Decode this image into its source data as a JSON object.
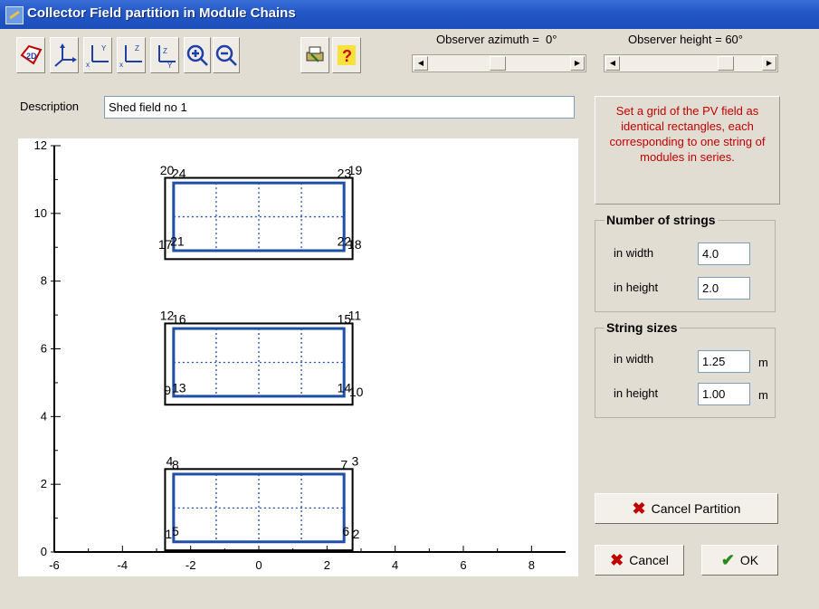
{
  "window": {
    "title": "Collector Field partition in Module Chains"
  },
  "toolbar": {
    "buttons": [
      {
        "name": "2d-view-icon",
        "glyph": "2D"
      },
      {
        "name": "3d-axes-icon"
      },
      {
        "name": "view-xy-icon"
      },
      {
        "name": "view-xz-icon"
      },
      {
        "name": "view-yz-icon"
      },
      {
        "name": "zoom-in-icon"
      },
      {
        "name": "zoom-out-icon"
      },
      {
        "name": "print-icon"
      },
      {
        "name": "help-icon",
        "glyph": "?"
      }
    ]
  },
  "observer": {
    "azimuth_label": "Observer azimuth =",
    "azimuth_value": "0°",
    "height_label": "Observer height =",
    "height_value": "60°"
  },
  "description": {
    "label": "Description",
    "value": "Shed field no 1"
  },
  "hint_text": "Set a grid of the PV field as identical rectangles, each corresponding to one string of modules in series.",
  "number_of_strings": {
    "title": "Number of strings",
    "width_label": "in width",
    "width_value": "4.0",
    "height_label": "in height",
    "height_value": "2.0"
  },
  "string_sizes": {
    "title": "String sizes",
    "width_label": "in width",
    "width_value": "1.25",
    "width_unit": "m",
    "height_label": "in height",
    "height_value": "1.00",
    "height_unit": "m"
  },
  "buttons": {
    "cancel_partition": "Cancel Partition",
    "cancel": "Cancel",
    "ok": "OK"
  },
  "colors": {
    "title_bar": "#2458c8",
    "hint_text": "#c00000",
    "field_outline": "#1e4fa8",
    "shed_outline": "#000000"
  },
  "chart_data": {
    "type": "diagram",
    "xlim": [
      -6,
      9
    ],
    "ylim": [
      0,
      12
    ],
    "x_ticks": [
      -6,
      -4,
      -2,
      0,
      2,
      4,
      6,
      8
    ],
    "y_ticks": [
      0,
      2,
      4,
      6,
      8,
      10,
      12
    ],
    "sheds": [
      {
        "outer": [
          -2.75,
          0.05,
          2.75,
          2.45
        ],
        "inner": [
          -2.5,
          0.3,
          2.5,
          2.3
        ],
        "hdiv": [
          1.3
        ],
        "vdiv": [
          -1.25,
          0,
          1.25
        ],
        "labels": [
          {
            "text": "4",
            "x": -2.72,
            "y": 2.55,
            "anchor": "start"
          },
          {
            "text": "8",
            "x": -2.55,
            "y": 2.45,
            "anchor": "start"
          },
          {
            "text": "7",
            "x": 2.4,
            "y": 2.45,
            "anchor": "start"
          },
          {
            "text": "3",
            "x": 2.72,
            "y": 2.55,
            "anchor": "start"
          },
          {
            "text": "1",
            "x": -2.75,
            "y": 0.4,
            "anchor": "start"
          },
          {
            "text": "5",
            "x": -2.55,
            "y": 0.48,
            "anchor": "start"
          },
          {
            "text": "6",
            "x": 2.45,
            "y": 0.48,
            "anchor": "start"
          },
          {
            "text": "2",
            "x": 2.75,
            "y": 0.4,
            "anchor": "start"
          }
        ]
      },
      {
        "outer": [
          -2.75,
          4.35,
          2.75,
          6.75
        ],
        "inner": [
          -2.5,
          4.6,
          2.5,
          6.6
        ],
        "hdiv": [
          5.6
        ],
        "vdiv": [
          -1.25,
          0,
          1.25
        ],
        "labels": [
          {
            "text": "12",
            "x": -2.9,
            "y": 6.85,
            "anchor": "start"
          },
          {
            "text": "16",
            "x": -2.55,
            "y": 6.75,
            "anchor": "start"
          },
          {
            "text": "15",
            "x": 2.3,
            "y": 6.75,
            "anchor": "start"
          },
          {
            "text": "11",
            "x": 2.62,
            "y": 6.85,
            "anchor": "start"
          },
          {
            "text": "9",
            "x": -2.78,
            "y": 4.65,
            "anchor": "start"
          },
          {
            "text": "13",
            "x": -2.55,
            "y": 4.72,
            "anchor": "start"
          },
          {
            "text": "14",
            "x": 2.3,
            "y": 4.72,
            "anchor": "start"
          },
          {
            "text": "10",
            "x": 2.65,
            "y": 4.6,
            "anchor": "start"
          }
        ]
      },
      {
        "outer": [
          -2.75,
          8.65,
          2.75,
          11.05
        ],
        "inner": [
          -2.5,
          8.9,
          2.5,
          10.9
        ],
        "hdiv": [
          9.9
        ],
        "vdiv": [
          -1.25,
          0,
          1.25
        ],
        "labels": [
          {
            "text": "20",
            "x": -2.9,
            "y": 11.15,
            "anchor": "start"
          },
          {
            "text": "24",
            "x": -2.55,
            "y": 11.05,
            "anchor": "start"
          },
          {
            "text": "23",
            "x": 2.3,
            "y": 11.05,
            "anchor": "start"
          },
          {
            "text": "19",
            "x": 2.62,
            "y": 11.15,
            "anchor": "start"
          },
          {
            "text": "17",
            "x": -2.95,
            "y": 8.95,
            "anchor": "start"
          },
          {
            "text": "21",
            "x": -2.6,
            "y": 9.05,
            "anchor": "start"
          },
          {
            "text": "22",
            "x": 2.3,
            "y": 9.05,
            "anchor": "start"
          },
          {
            "text": "18",
            "x": 2.6,
            "y": 8.95,
            "anchor": "start"
          }
        ]
      }
    ]
  }
}
